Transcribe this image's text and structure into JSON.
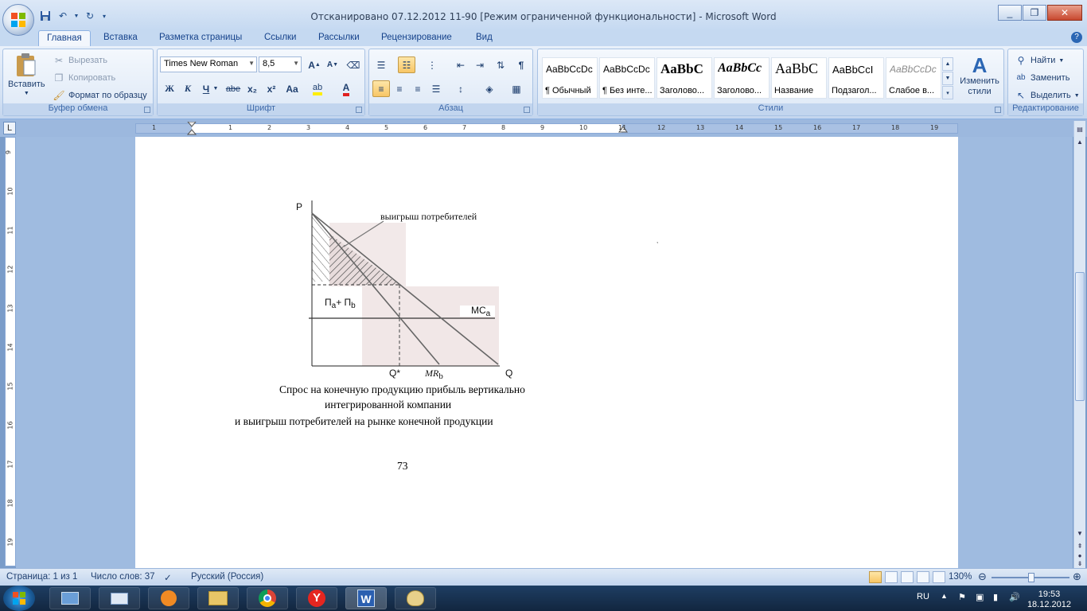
{
  "window": {
    "title": "Отсканировано 07.12.2012 11-90 [Режим ограниченной функциональности] - Microsoft Word"
  },
  "tabs": [
    "Главная",
    "Вставка",
    "Разметка страницы",
    "Ссылки",
    "Рассылки",
    "Рецензирование",
    "Вид"
  ],
  "ribbon": {
    "clipboard": {
      "label": "Буфер обмена",
      "paste": "Вставить",
      "cut": "Вырезать",
      "copy": "Копировать",
      "format_painter": "Формат по образцу"
    },
    "font": {
      "label": "Шрифт",
      "family": "Times New Roman",
      "size": "8,5",
      "bold": "Ж",
      "italic": "К",
      "underline": "Ч",
      "strike": "abe",
      "subscript": "x₂",
      "superscript": "x²",
      "change_case": "Aa"
    },
    "paragraph": {
      "label": "Абзац"
    },
    "styles": {
      "label": "Стили",
      "items": [
        {
          "sample": "AaBbCcDc",
          "name": "¶ Обычный"
        },
        {
          "sample": "AaBbCcDc",
          "name": "¶ Без инте..."
        },
        {
          "sample": "AaBbC",
          "name": "Заголово..."
        },
        {
          "sample": "AaBbCc",
          "name": "Заголово..."
        },
        {
          "sample": "AaBbC",
          "name": "Название"
        },
        {
          "sample": "AaBbCcI",
          "name": "Подзагол..."
        },
        {
          "sample": "AaBbCcDc",
          "name": "Слабое в..."
        }
      ],
      "change_styles": "Изменить стили"
    },
    "editing": {
      "label": "Редактирование",
      "find": "Найти",
      "replace": "Заменить",
      "select": "Выделить"
    }
  },
  "ruler": {
    "h_numbers": [
      "1",
      "1",
      "2",
      "3",
      "4",
      "5",
      "6",
      "7",
      "8",
      "9",
      "10",
      "11",
      "12",
      "13",
      "14",
      "15",
      "16",
      "17",
      "18",
      "19"
    ],
    "v_numbers": [
      "9",
      "10",
      "11",
      "12",
      "13",
      "14",
      "15",
      "16",
      "17",
      "18",
      "19"
    ]
  },
  "document": {
    "chart_data": {
      "type": "diagram",
      "labels": {
        "y_axis": "P",
        "consumer_surplus": "выигрыш потребителей",
        "profit_main": "П",
        "profit_sub_a": "a",
        "profit_plus": "+ П",
        "profit_sub_b": "b",
        "mc": "MC",
        "mc_sub": "a",
        "q_star": "Q*",
        "mr": "MR",
        "mr_sub": "b",
        "x_axis": "Q"
      }
    },
    "caption_line1": "Спрос на конечную продукцию прибыль вертикально",
    "caption_line2": "интегрированной компании",
    "caption_line3": "и выигрыш потребителей  на рынке конечной продукции",
    "page_number": "73"
  },
  "status": {
    "page": "Страница: 1 из 1",
    "words": "Число слов: 37",
    "language": "Русский (Россия)",
    "zoom": "130%"
  },
  "taskbar": {
    "lang": "RU",
    "time": "19:53",
    "date": "18.12.2012"
  }
}
